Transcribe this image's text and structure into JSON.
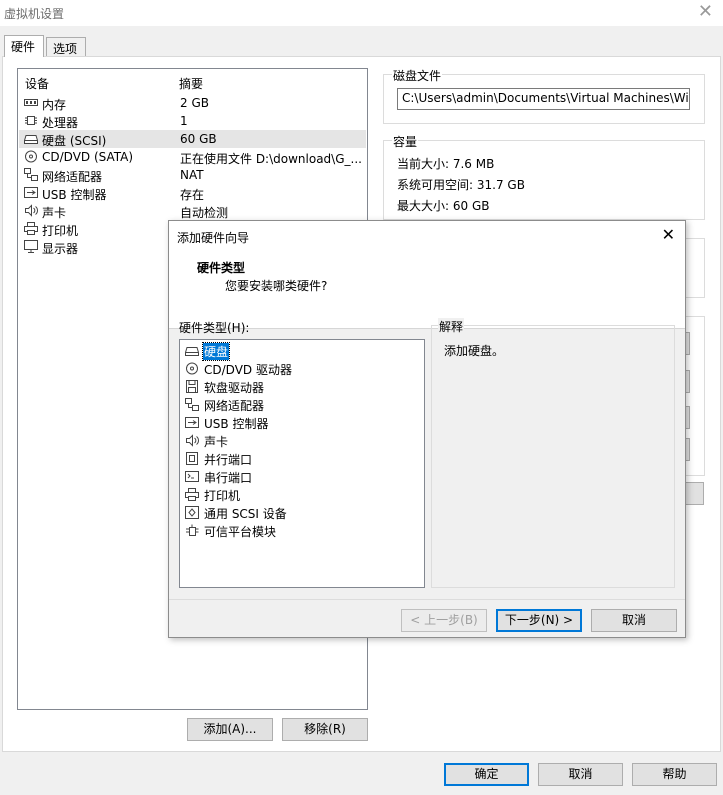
{
  "window": {
    "title": "虚拟机设置"
  },
  "tabs": [
    "硬件",
    "选项"
  ],
  "device_list": {
    "headers": {
      "device": "设备",
      "summary": "摘要"
    },
    "rows": [
      {
        "icon": "memory-icon",
        "name": "内存",
        "summary": "2 GB"
      },
      {
        "icon": "cpu-icon",
        "name": "处理器",
        "summary": "1"
      },
      {
        "icon": "hard-disk-icon",
        "name": "硬盘 (SCSI)",
        "summary": "60 GB",
        "selected": true
      },
      {
        "icon": "cd-dvd-icon",
        "name": "CD/DVD (SATA)",
        "summary": "正在使用文件 D:\\download\\G_..."
      },
      {
        "icon": "network-adapter-icon",
        "name": "网络适配器",
        "summary": "NAT"
      },
      {
        "icon": "usb-controller-icon",
        "name": "USB 控制器",
        "summary": "存在"
      },
      {
        "icon": "sound-card-icon",
        "name": "声卡",
        "summary": "自动检测"
      },
      {
        "icon": "printer-icon",
        "name": "打印机",
        "summary": ""
      },
      {
        "icon": "display-icon",
        "name": "显示器",
        "summary": ""
      }
    ]
  },
  "buttons": {
    "add": "添加(A)...",
    "remove": "移除(R)",
    "ok": "确定",
    "cancel": "取消",
    "help": "帮助"
  },
  "disk_file": {
    "group_title": "磁盘文件",
    "path": "C:\\Users\\admin\\Documents\\Virtual Machines\\Windov"
  },
  "capacity": {
    "group_title": "容量",
    "current_size": "当前大小: 7.6 MB",
    "system_free": "系统可用空间: 31.7 GB",
    "max_size": "最大大小: 60 GB"
  },
  "wizard": {
    "title": "添加硬件向导",
    "heading": "硬件类型",
    "subheading": "您要安装哪类硬件?",
    "list_label": "硬件类型(H):",
    "items": [
      {
        "icon": "hard-disk-icon",
        "name": "硬盘",
        "selected": true
      },
      {
        "icon": "cd-dvd-icon",
        "name": "CD/DVD 驱动器"
      },
      {
        "icon": "floppy-icon",
        "name": "软盘驱动器"
      },
      {
        "icon": "network-adapter-icon",
        "name": "网络适配器"
      },
      {
        "icon": "usb-controller-icon",
        "name": "USB 控制器"
      },
      {
        "icon": "sound-card-icon",
        "name": "声卡"
      },
      {
        "icon": "parallel-port-icon",
        "name": "并行端口"
      },
      {
        "icon": "serial-port-icon",
        "name": "串行端口"
      },
      {
        "icon": "printer-icon",
        "name": "打印机"
      },
      {
        "icon": "generic-scsi-icon",
        "name": "通用 SCSI 设备"
      },
      {
        "icon": "tpm-icon",
        "name": "可信平台模块"
      }
    ],
    "explain_title": "解释",
    "explain_text": "添加硬盘。",
    "back": "< 上一步(B)",
    "next": "下一步(N) >",
    "cancel": "取消"
  }
}
